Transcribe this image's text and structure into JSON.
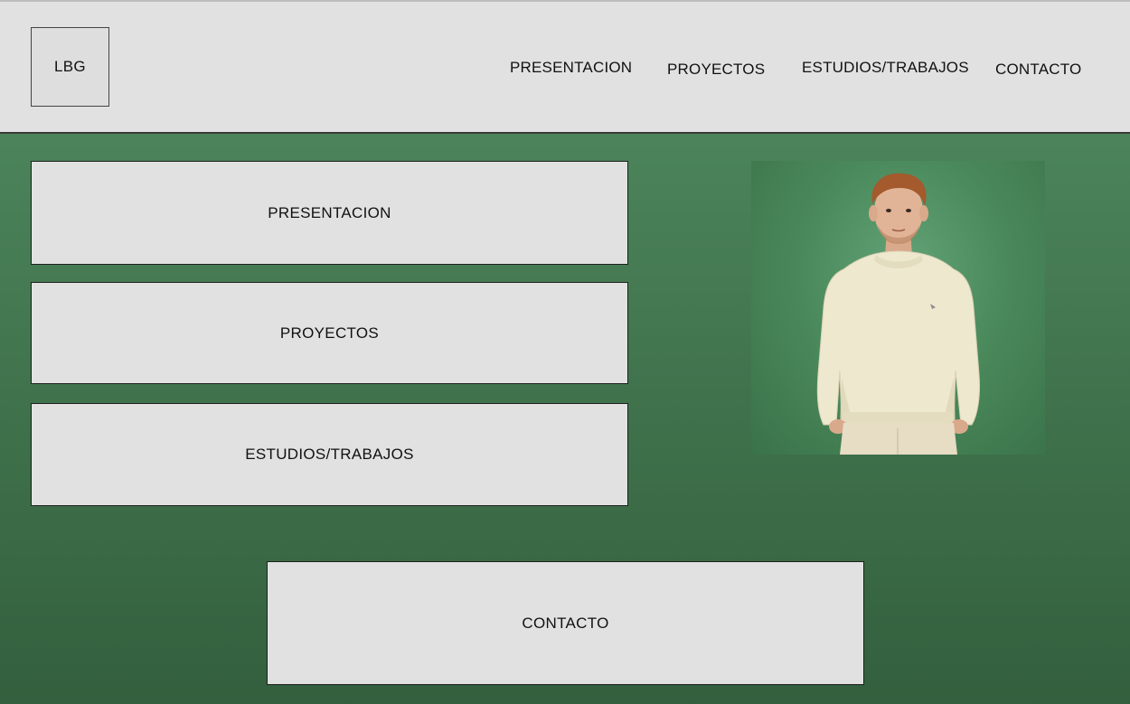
{
  "header": {
    "logo_text": "LBG",
    "nav": [
      {
        "label": "PRESENTACION"
      },
      {
        "label": "PROYECTOS"
      },
      {
        "label": "ESTUDIOS/TRABAJOS"
      },
      {
        "label": "CONTACTO"
      }
    ]
  },
  "main": {
    "cards": [
      {
        "label": "PRESENTACION"
      },
      {
        "label": "PROYECTOS"
      },
      {
        "label": "ESTUDIOS/TRABAJOS"
      },
      {
        "label": "CONTACTO"
      }
    ],
    "photo": {
      "subject": "portrait-photo"
    }
  },
  "colors": {
    "header_bg": "#e1e1e1",
    "page_green_top": "#538c61",
    "page_green_bottom": "#335f3e",
    "card_bg": "#e1e1e1",
    "sweater": "#eee8cf",
    "hair": "#a45a2c"
  }
}
